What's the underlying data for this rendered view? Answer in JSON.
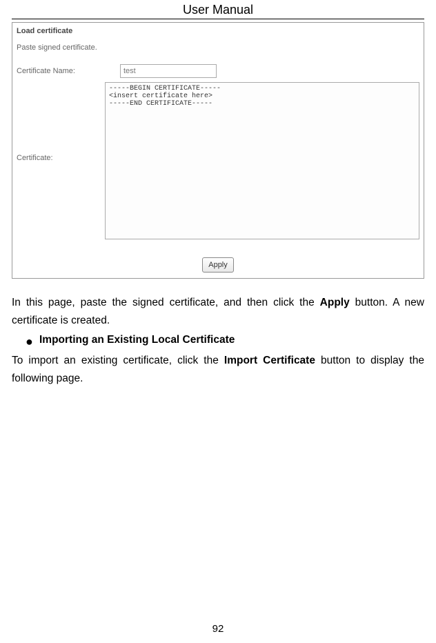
{
  "header": "User Manual",
  "screenshot": {
    "title": "Load certificate",
    "subtitle": "Paste signed certificate.",
    "cert_name_label": "Certificate Name:",
    "cert_name_value": "test",
    "cert_label": "Certificate:",
    "cert_textarea_value": "-----BEGIN CERTIFICATE-----\n<insert certificate here>\n-----END CERTIFICATE-----",
    "apply_label": "Apply"
  },
  "para1": {
    "part1": "In this page, paste the signed certificate, and then click the ",
    "bold1": "Apply",
    "part2": " button. A new certificate is created."
  },
  "bullet": {
    "text": "Importing an Existing Local Certificate"
  },
  "para2": {
    "part1": "To import an existing certificate, click the ",
    "bold1": "Import Certificate",
    "part2": " button to display the following page."
  },
  "page_number": "92"
}
